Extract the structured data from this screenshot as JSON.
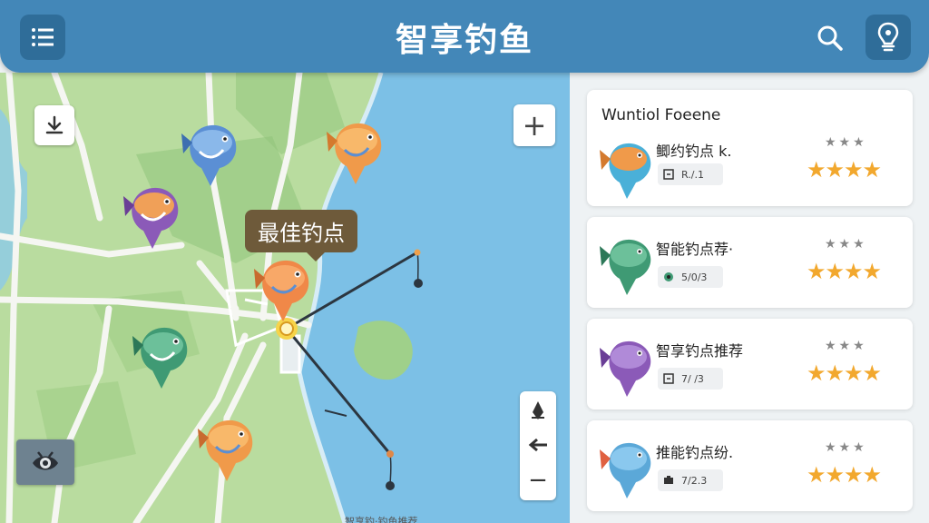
{
  "header": {
    "title": "智享钓鱼",
    "menu_icon": "list-icon",
    "search_icon": "search-icon",
    "profile_icon": "bulb-pin-icon"
  },
  "map": {
    "tooltip": "最佳钓点",
    "bottom_text": "智享钓·钓鱼推荐",
    "controls": {
      "download_icon": "download-icon",
      "zoom_in": "+",
      "compass_icon": "compass-icon",
      "back_icon": "arrow-left-icon",
      "zoom_out": "−",
      "camera_icon": "eye-camera-icon"
    },
    "fish_markers": [
      {
        "name": "fish-marker-blue",
        "color": "#5b8fd4"
      },
      {
        "name": "fish-marker-orange-top",
        "color": "#f09a4a"
      },
      {
        "name": "fish-marker-purple",
        "color": "#8b5ab8"
      },
      {
        "name": "fish-marker-orange-center",
        "color": "#f08848"
      },
      {
        "name": "fish-marker-green",
        "color": "#3f9a74"
      },
      {
        "name": "fish-marker-orange-bottom",
        "color": "#f09a4a"
      }
    ]
  },
  "panel": {
    "cards": [
      {
        "heading": "Wuntiol Foeene",
        "name": "鲫约钓点 k.",
        "chip_text": "R./.1",
        "grey_stars": "★★★",
        "gold_stars": "★★★★",
        "fish_color": "#f09a4a",
        "pin_color": "#4ab0d8"
      },
      {
        "name": "智能钓点荐·",
        "chip_text": "5/0/3",
        "grey_stars": "★★★",
        "gold_stars": "★★★★",
        "fish_color": "#3f9a74",
        "pin_color": "#3f9a74"
      },
      {
        "name": "智享钓点推荐",
        "chip_text": "7/ /3",
        "grey_stars": "★★★",
        "gold_stars": "★★★★",
        "fish_color": "#8b5ab8",
        "pin_color": "#8b5ab8"
      },
      {
        "name": "推能钓点纷.",
        "chip_text": "7/2.3",
        "grey_stars": "★★★",
        "gold_stars": "★★★★",
        "fish_color": "#5ba8d8",
        "pin_color": "#e06040"
      }
    ]
  },
  "colors": {
    "header": "#4387b8",
    "water": "#7cc0e6",
    "land": "#b9dc9f",
    "star": "#f2a82e"
  }
}
